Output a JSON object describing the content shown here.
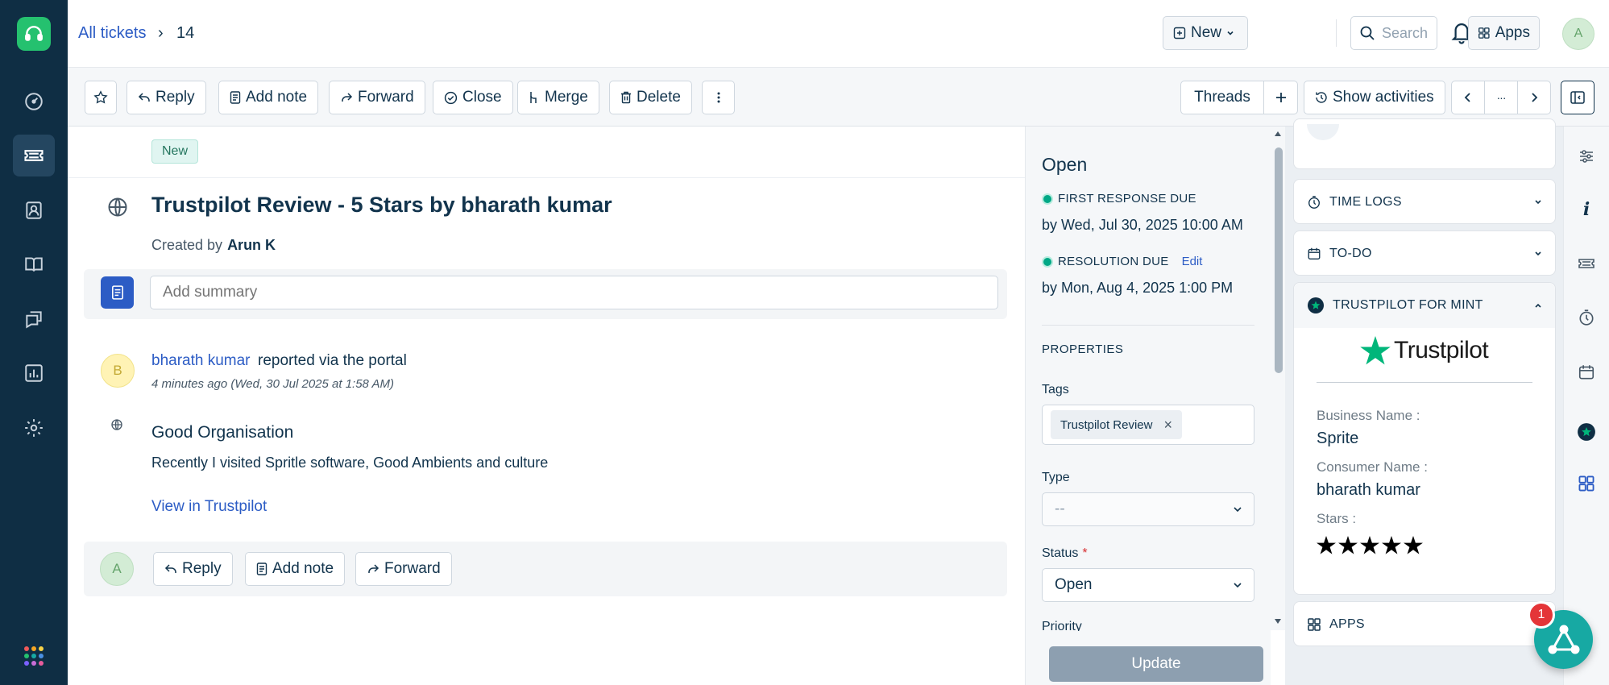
{
  "colors": {
    "nav_bg": "#0f2e44",
    "accent": "#2c5cc5",
    "brand_green": "#25c16f",
    "trustpilot_green": "#00b67a",
    "sla_green": "#00a886",
    "update_disabled": "#8d9fb0",
    "fab": "#17a9a3",
    "badge_red": "#e43538"
  },
  "nav": {
    "logo_icon": "headset-icon",
    "items": [
      {
        "name": "dashboard",
        "icon": "gauge-icon"
      },
      {
        "name": "tickets",
        "icon": "ticket-icon",
        "active": true
      },
      {
        "name": "contacts",
        "icon": "contact-icon"
      },
      {
        "name": "solutions",
        "icon": "book-icon"
      },
      {
        "name": "discussions",
        "icon": "chat-icon"
      },
      {
        "name": "reports",
        "icon": "bar-chart-icon"
      },
      {
        "name": "admin",
        "icon": "gear-icon"
      }
    ],
    "app_switcher_icon": "dots-grid-icon"
  },
  "header": {
    "breadcrumb_link": "All tickets",
    "breadcrumb_sep": "›",
    "ticket_number": "14",
    "new_label": "New",
    "search_placeholder": "Search",
    "apps_label": "Apps",
    "user_initial": "A"
  },
  "toolbar": {
    "reply": "Reply",
    "add_note": "Add note",
    "forward": "Forward",
    "close": "Close",
    "merge": "Merge",
    "delete": "Delete",
    "threads": "Threads",
    "show_activities": "Show activities",
    "more_dots": "···"
  },
  "ticket": {
    "status_pill": "New",
    "title": "Trustpilot Review - 5 Stars by bharath kumar",
    "created_by_label": "Created by",
    "created_by": "Arun K",
    "summary_placeholder": "Add summary"
  },
  "message": {
    "avatar_initial": "B",
    "author": "bharath kumar",
    "via": "reported via the portal",
    "time": "4 minutes ago (Wed, 30 Jul 2025 at 1:58 AM)",
    "subject": "Good Organisation",
    "body": "Recently I visited Spritle software, Good Ambients and culture",
    "link": "View in Trustpilot"
  },
  "reply_bar": {
    "avatar_initial": "A",
    "reply": "Reply",
    "add_note": "Add note",
    "forward": "Forward"
  },
  "properties": {
    "status_heading": "Open",
    "first_response_label": "FIRST RESPONSE DUE",
    "first_response_date": "by Wed, Jul 30, 2025 10:00 AM",
    "resolution_label": "RESOLUTION DUE",
    "resolution_edit": "Edit",
    "resolution_date": "by Mon, Aug 4, 2025 1:00 PM",
    "section_heading": "PROPERTIES",
    "tags_label": "Tags",
    "tag": "Trustpilot Review",
    "tag_remove": "×",
    "type_label": "Type",
    "type_value": "--",
    "status_label": "Status",
    "status_required": "*",
    "status_value": "Open",
    "priority_label": "Priority",
    "update_button": "Update"
  },
  "widgets": {
    "time_logs": "TIME LOGS",
    "todo": "TO-DO",
    "trustpilot_header": "TRUSTPILOT FOR MINT",
    "trustpilot_logo": "Trustpilot",
    "business_name_label": "Business Name :",
    "business_name": "Sprite",
    "consumer_name_label": "Consumer Name :",
    "consumer_name": "bharath kumar",
    "stars_label": "Stars :",
    "stars": 5,
    "apps": "APPS"
  },
  "fab": {
    "badge": "1",
    "icon": "triangle-nodes-icon"
  }
}
